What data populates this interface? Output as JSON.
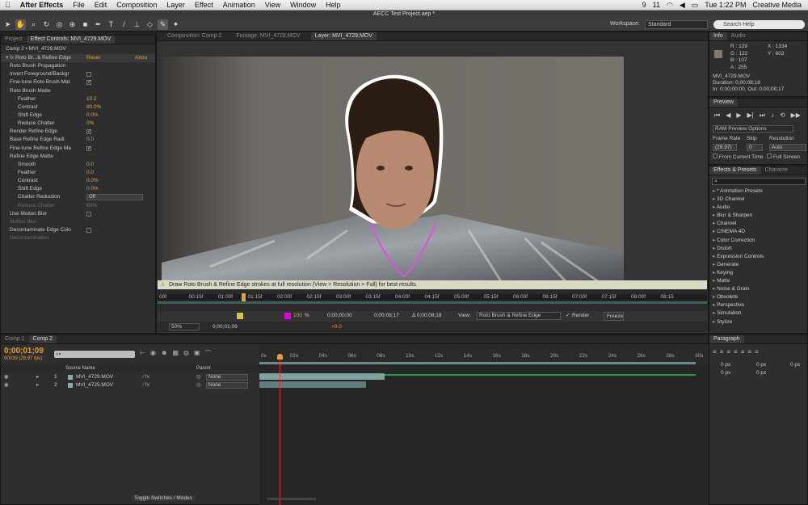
{
  "menubar": {
    "app": "After Effects",
    "items": [
      "File",
      "Edit",
      "Composition",
      "Layer",
      "Effect",
      "Animation",
      "View",
      "Window",
      "Help"
    ],
    "status": {
      "badge1": "9",
      "badge2": "11",
      "time": "Tue 1:22 PM",
      "user": "Creative Media"
    }
  },
  "window_title": "AECC Test Project.aep *",
  "toolbar": {
    "workspace_label": "Workspace:",
    "workspace_value": "Standard",
    "search_placeholder": "Search Help"
  },
  "left_panel": {
    "tabs": [
      "Project",
      "Effect Controls: MVI_4729.MOV"
    ],
    "header": "Comp 2 • MVI_4729.MOV",
    "effect": {
      "name": "Roto Br...& Refine Edge",
      "reset": "Reset",
      "about": "Abou"
    },
    "rows": [
      {
        "label": "Roto Brush Propagation",
        "indent": 1,
        "value": ""
      },
      {
        "label": "Invert Foreground/Backgr",
        "indent": 1,
        "check": ""
      },
      {
        "label": "Fine-tune Roto Brush Mat",
        "indent": 1,
        "check": "✓"
      },
      {
        "label": "Roto Brush Matte",
        "indent": 1,
        "value": ""
      },
      {
        "label": "Feather",
        "indent": 3,
        "value": "10.2"
      },
      {
        "label": "Contrast",
        "indent": 3,
        "value": "80.0%"
      },
      {
        "label": "Shift Edge",
        "indent": 3,
        "value": "0.0%"
      },
      {
        "label": "Reduce Chatter",
        "indent": 3,
        "value": "0%"
      },
      {
        "label": "Render Refine Edge",
        "indent": 1,
        "check": "✓"
      },
      {
        "label": "Base Refine Edge Radi",
        "indent": 1,
        "value": "0.0"
      },
      {
        "label": "Fine-tune Refine Edge Ma",
        "indent": 1,
        "check": "✓"
      },
      {
        "label": "Refine Edge Matte",
        "indent": 1,
        "value": ""
      },
      {
        "label": "Smooth",
        "indent": 3,
        "value": "0.0"
      },
      {
        "label": "Feather",
        "indent": 3,
        "value": "0.0"
      },
      {
        "label": "Contrast",
        "indent": 3,
        "value": "0.0%"
      },
      {
        "label": "Shift Edge",
        "indent": 3,
        "value": "0.0%"
      },
      {
        "label": "Chatter Reduction",
        "indent": 3,
        "select": "Off"
      },
      {
        "label": "Reduce Chatter",
        "indent": 3,
        "value": "50%",
        "dim": true
      },
      {
        "label": "Use Motion Blur",
        "indent": 1,
        "check": ""
      },
      {
        "label": "Motion Blur",
        "indent": 1,
        "value": "",
        "dim": true
      },
      {
        "label": "Decontaminate Edge Colo",
        "indent": 1,
        "check": ""
      },
      {
        "label": "Decontamination",
        "indent": 1,
        "value": "",
        "dim": true
      }
    ]
  },
  "viewer": {
    "tabs": [
      "Composition: Comp 2",
      "Footage: MVI_4728.MOV",
      "Layer: MVI_4729.MOV"
    ],
    "warning": "Draw Roto Brush & Refine Edge strokes at full resolution (View > Resolution > Full) for best results.",
    "ruler": [
      "00f",
      "00:15f",
      "01:00f",
      "01:15f",
      "02:00f",
      "02:15f",
      "03:00f",
      "03:15f",
      "04:00f",
      "04:15f",
      "05:00f",
      "05:15f",
      "06:00f",
      "06:15f",
      "07:00f",
      "07:15f",
      "08:00f",
      "08:15"
    ],
    "controls": {
      "zoom_pct": "100",
      "time_in": "0;00;00;00",
      "time_out": "0;00;08;17",
      "delta": "Δ 0;00;08;18",
      "view_label": "View:",
      "view_value": "Roto Brush & Refine Edge",
      "render": "Render",
      "freeze": "Freeze"
    },
    "footer": {
      "zoom": "50%",
      "time": "0;00;01;09",
      "offset": "+0.0"
    }
  },
  "info": {
    "tabs": [
      "Info",
      "Audio"
    ],
    "r": "R : 129",
    "g": "G : 122",
    "b": "B : 107",
    "a": "A : 255",
    "x": "X : 1334",
    "y": "Y : 602",
    "clip": "MVI_4729.MOV",
    "duration": "Duration: 0;00;08;18",
    "inout": "In: 0;00;00;00, Out: 0;00;08;17"
  },
  "preview": {
    "tab": "Preview",
    "ram": "RAM Preview Options",
    "frame_rate_label": "Frame Rate",
    "skip_label": "Skip",
    "resolution_label": "Resolution",
    "frame_rate": "(29.97)",
    "skip": "0",
    "resolution": "Auto",
    "from_current": "From Current Time",
    "full_screen": "Full Screen"
  },
  "effects": {
    "tabs": [
      "Effects & Presets",
      "Characte"
    ],
    "items": [
      "* Animation Presets",
      "3D Channel",
      "Audio",
      "Blur & Sharpen",
      "Channel",
      "CINEMA 4D",
      "Color Correction",
      "Distort",
      "Expression Controls",
      "Generate",
      "Keying",
      "Matte",
      "Noise & Grain",
      "Obsolete",
      "Perspective",
      "Simulation",
      "Stylize"
    ]
  },
  "paragraph": {
    "tab": "Paragraph",
    "px": "0 px"
  },
  "timeline": {
    "tabs": [
      "Comp 1",
      "Comp 2"
    ],
    "timecode": "0;00;01;09",
    "fps": "00039 (29.97 fps)",
    "col_source": "Source Name",
    "col_parent": "Parent",
    "layers": [
      {
        "num": "1",
        "name": "MVI_4729.MOV",
        "parent": "None"
      },
      {
        "num": "2",
        "name": "MVI_4725.MOV",
        "parent": "None"
      }
    ],
    "ticks": [
      "0s",
      "02s",
      "04s",
      "06s",
      "08s",
      "10s",
      "12s",
      "14s",
      "16s",
      "18s",
      "20s",
      "22s",
      "24s",
      "26s",
      "28s",
      "30s"
    ],
    "toggle": "Toggle Switches / Modes"
  }
}
